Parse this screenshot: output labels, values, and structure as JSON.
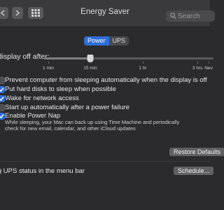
{
  "window": {
    "title": "Energy Saver",
    "search_placeholder": "Search"
  },
  "toolbar": {
    "back_icon": "chevron-left-icon",
    "forward_icon": "chevron-right-icon",
    "show_all_icon": "grid-icon"
  },
  "tabs": [
    {
      "label": "Power",
      "selected": true
    },
    {
      "label": "UPS",
      "selected": false
    }
  ],
  "display_sleep": {
    "label": "n display off after:",
    "slider_value": "15 min",
    "tick_labels": [
      "1 min",
      "15 min",
      "1 hr",
      "3 hrs",
      "Nev"
    ]
  },
  "options": [
    {
      "label": "Prevent computer from sleeping automatically when the display is off",
      "checked": false
    },
    {
      "label": "Put hard disks to sleep when possible",
      "checked": true
    },
    {
      "label": "Wake for network access",
      "checked": true
    },
    {
      "label": "Start up automatically after a power failure",
      "checked": false
    },
    {
      "label": "Enable Power Nap",
      "checked": true
    }
  ],
  "power_nap_description": "While sleeping, your Mac can back up using Time Machine and periodically check for new email, calendar, and other iCloud updates",
  "buttons": {
    "restore_defaults": "Restore Defaults",
    "schedule": "Schedule..."
  },
  "ups_status_label": "ow UPS status in the menu bar",
  "colors": {
    "accent": "#2e6ed8",
    "window_bg": "#2b2b2d",
    "titlebar_bg": "#3a3a3c"
  }
}
